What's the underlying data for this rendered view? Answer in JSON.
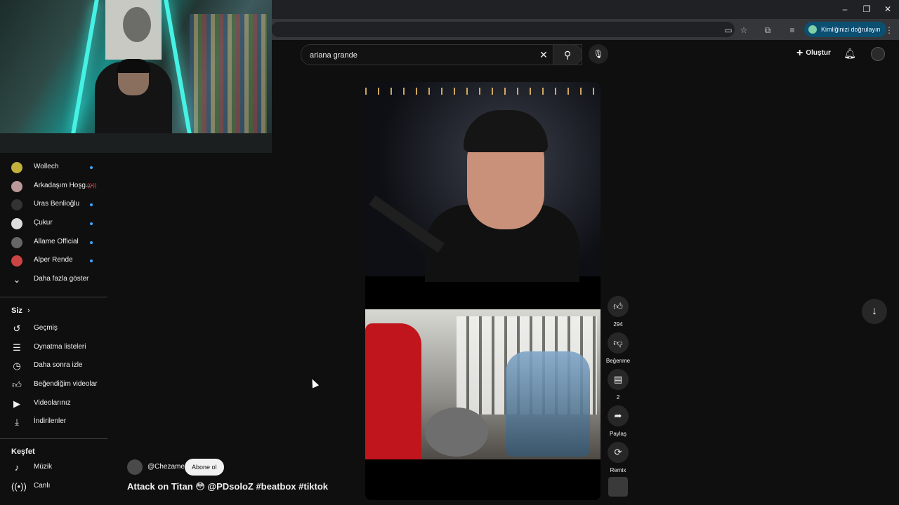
{
  "browser": {
    "verify_label": "Kimliğinizi doğrulayın",
    "window_controls": [
      "–",
      "❐",
      "✕"
    ]
  },
  "sidebar": {
    "subscriptions": [
      {
        "label": "Wollech",
        "avatar_color": "#c2b03a",
        "indicator": "dot"
      },
      {
        "label": "Arkadaşım Hoşg...",
        "avatar_color": "#b99",
        "indicator": "live"
      },
      {
        "label": "Uras Benlioğlu",
        "avatar_color": "#333",
        "indicator": "dot"
      },
      {
        "label": "Çukur",
        "avatar_color": "#ddd",
        "indicator": "dot"
      },
      {
        "label": "Allame Official",
        "avatar_color": "#666",
        "indicator": "dot"
      },
      {
        "label": "Alper Rende",
        "avatar_color": "#c44",
        "indicator": "dot"
      }
    ],
    "show_more": "Daha fazla göster",
    "you_heading": "Siz",
    "you_items": [
      {
        "label": "Geçmiş",
        "icon": "history-icon"
      },
      {
        "label": "Oynatma listeleri",
        "icon": "playlists-icon"
      },
      {
        "label": "Daha sonra izle",
        "icon": "watch-later-icon"
      },
      {
        "label": "Beğendiğim videolar",
        "icon": "liked-icon"
      },
      {
        "label": "Videolarınız",
        "icon": "your-videos-icon"
      },
      {
        "label": "İndirilenler",
        "icon": "downloads-icon"
      }
    ],
    "explore_heading": "Keşfet",
    "explore_items": [
      {
        "label": "Müzik",
        "icon": "music-icon"
      },
      {
        "label": "Canlı",
        "icon": "live-icon"
      }
    ]
  },
  "header": {
    "search_value": "ariana grande",
    "create_label": "Oluştur"
  },
  "short": {
    "channel": "@Chezame",
    "subscribe_label": "Abone ol",
    "caption": "Attack on Titan 😳 @PDsoloZ  #beatbox #tiktok",
    "actions": {
      "like_count": "294",
      "dislike_label": "Beğenme",
      "comment_count": "2",
      "share_label": "Paylaş",
      "remix_label": "Remix"
    }
  }
}
